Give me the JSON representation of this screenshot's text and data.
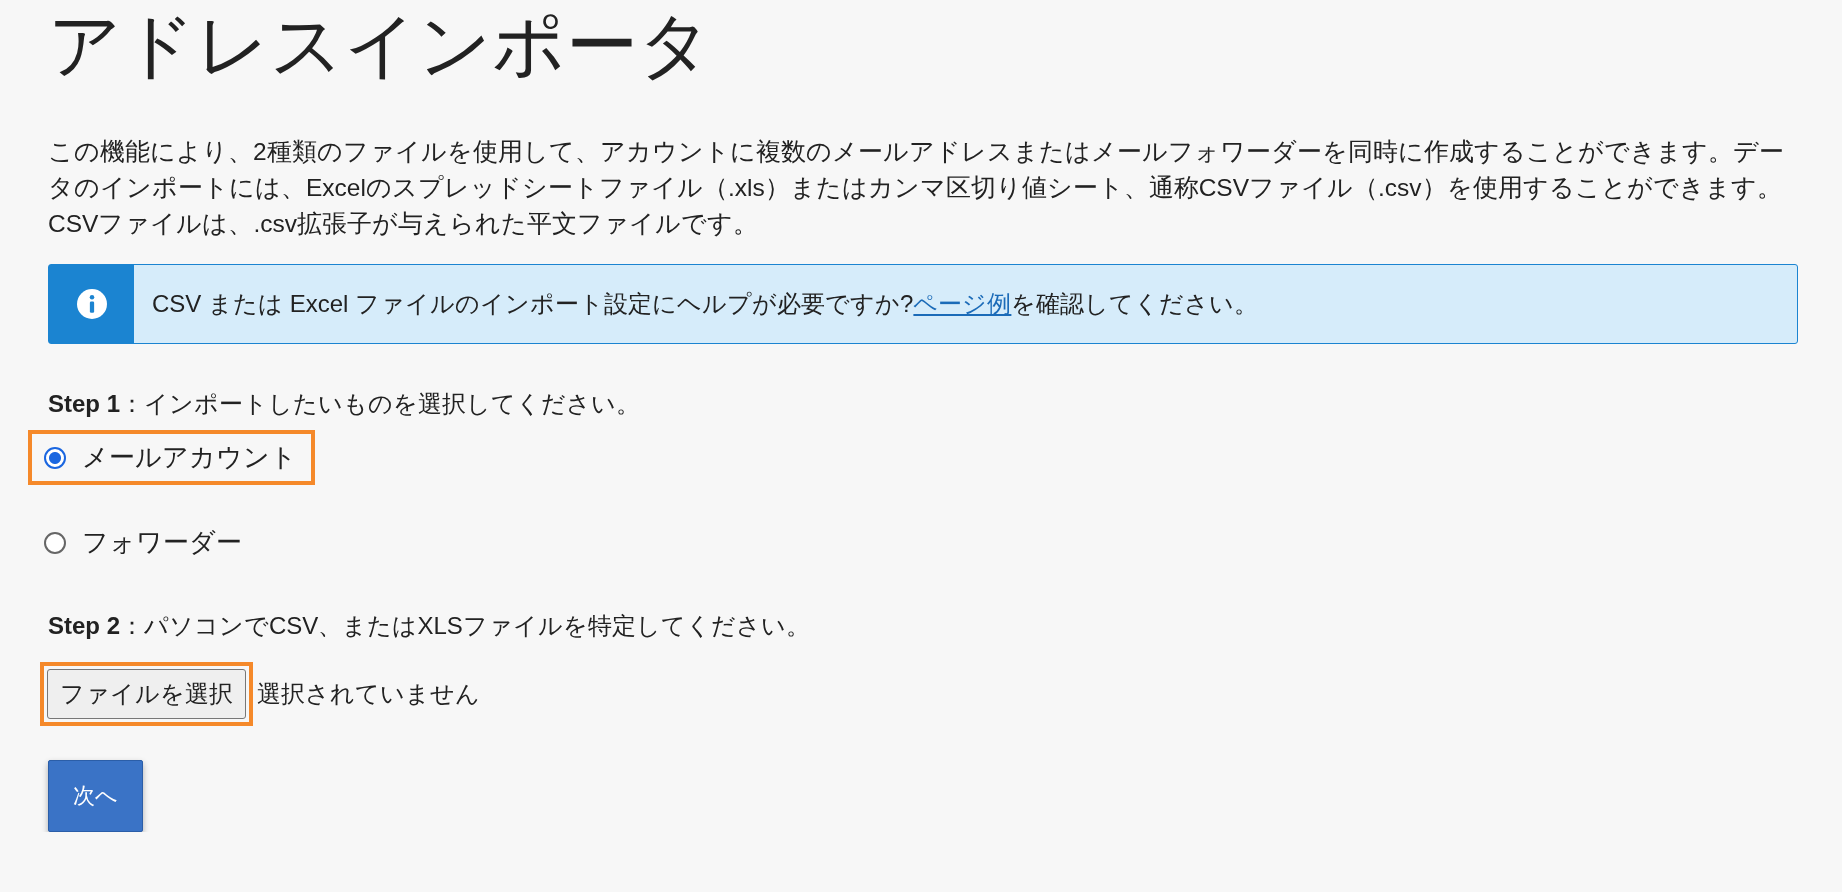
{
  "page": {
    "title": "アドレスインポータ"
  },
  "intro": "この機能により、2種類のファイルを使用して、アカウントに複数のメールアドレスまたはメールフォワーダーを同時に作成することができます。データのインポートには、Excelのスプレッドシートファイル（.xls）またはカンマ区切り値シート、通称CSVファイル（.csv）を使用することができます。CSVファイルは、.csv拡張子が与えられた平文ファイルです。",
  "alert": {
    "text": "CSV または Excel ファイルのインポート設定にヘルプが必要ですか?",
    "link": "ページ例",
    "suffix": "を確認してください。"
  },
  "step1": {
    "text": "**Step 1**：インポートしたいものを選択してください。",
    "options": [
      {
        "label": "メールアカウント",
        "selected": true,
        "highlighted": true
      },
      {
        "label": "フォワーダー",
        "selected": false,
        "highlighted": false
      }
    ]
  },
  "step2": {
    "text": "**Step 2**：パソコンでCSV、またはXLSファイルを特定してください。",
    "file_button": {
      "label": "ファイルを選択",
      "highlighted": true
    },
    "file_status": "選択されていません"
  },
  "next_button": "次へ"
}
